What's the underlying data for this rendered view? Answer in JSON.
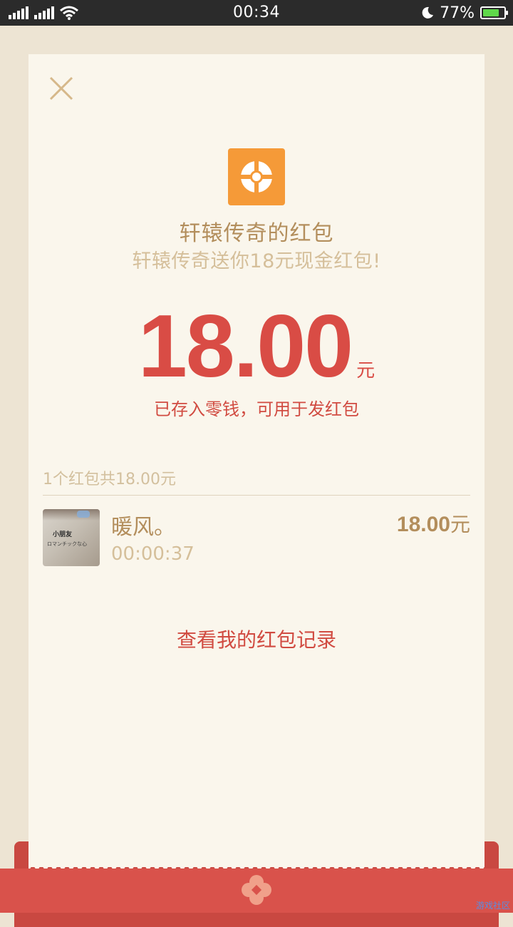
{
  "status_bar": {
    "time": "00:34",
    "battery_percent": "77%",
    "battery_level": 0.77,
    "signal_icons": [
      "signal-bars-icon",
      "signal-bars-icon",
      "wifi-icon"
    ],
    "moon_icon": "moon-icon"
  },
  "card": {
    "close_icon": "close-icon",
    "app_logo_icon": "app-logo-icon",
    "title": "轩辕传奇的红包",
    "subtitle": "轩辕传奇送你18元现金红包!",
    "amount": "18.00",
    "amount_unit": "元",
    "stored_note": "已存入零钱，可用于发红包",
    "summary": "1个红包共18.00元",
    "recipient": {
      "name": "暖风。",
      "time": "00:00:37",
      "amount": "18.00",
      "amount_unit": "元",
      "avatar_text_1": "小朋友",
      "avatar_text_2": "ロマンチックな心"
    },
    "history_link": "查看我的红包记录"
  },
  "colors": {
    "accent_red": "#d94c45",
    "gold": "#b38e5c",
    "light_gold": "#d5bf9a",
    "logo_orange": "#f59a38",
    "background": "#ede4d3",
    "card": "#faf6ec"
  },
  "watermark": "游戏社区"
}
